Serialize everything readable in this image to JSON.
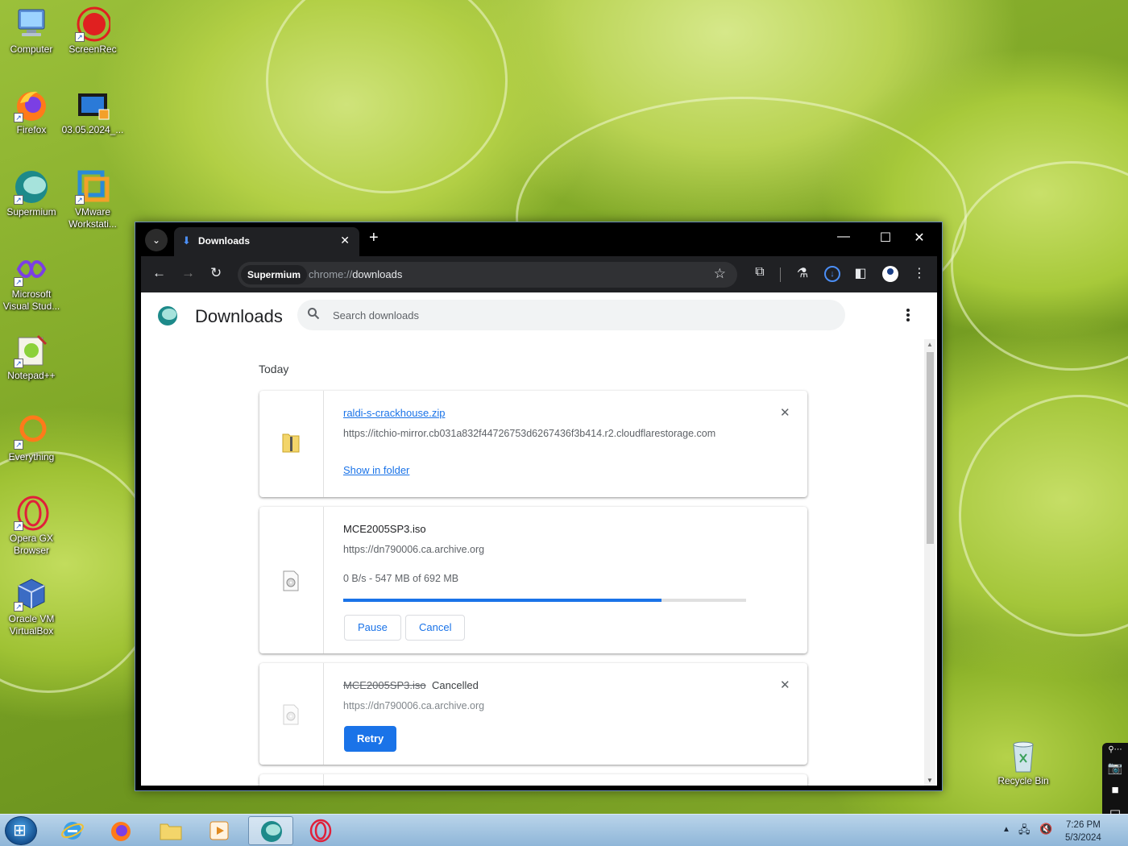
{
  "desktop": {
    "icons": [
      {
        "label": "Computer"
      },
      {
        "label": "ScreenRec"
      },
      {
        "label": "Firefox"
      },
      {
        "label": "03.05.2024_..."
      },
      {
        "label": "Supermium"
      },
      {
        "label": "VMware Workstati..."
      },
      {
        "label": "Microsoft Visual Stud..."
      },
      {
        "label": "Notepad++"
      },
      {
        "label": "Everything"
      },
      {
        "label": "Opera GX Browser"
      },
      {
        "label": "Oracle VM VirtualBox"
      },
      {
        "label": "Recycle Bin"
      }
    ]
  },
  "browser": {
    "tab_title": "Downloads",
    "omnibox": {
      "chip": "Supermium",
      "scheme": "chrome://",
      "host": "downloads"
    },
    "colors": {
      "accent": "#1a73e8",
      "frame": "#000000",
      "toolbar": "#202124"
    }
  },
  "downloads_page": {
    "title": "Downloads",
    "search_placeholder": "Search downloads",
    "section_label": "Today",
    "items": [
      {
        "filename": "raldi-s-crackhouse.zip",
        "url": "https://itchio-mirror.cb031a832f44726753d6267436f3b414.r2.cloudflarestorage.com",
        "action_link": "Show in folder"
      },
      {
        "filename": "MCE2005SP3.iso",
        "url": "https://dn790006.ca.archive.org",
        "progress_text": "0 B/s - 547 MB of 692 MB",
        "progress_fraction": 0.79,
        "pause_label": "Pause",
        "cancel_label": "Cancel"
      },
      {
        "filename": "MCE2005SP3.iso",
        "status": "Cancelled",
        "url": "https://dn790006.ca.archive.org",
        "retry_label": "Retry"
      }
    ]
  },
  "taskbar": {
    "clock_time": "7:26 PM",
    "clock_date": "5/3/2024"
  }
}
